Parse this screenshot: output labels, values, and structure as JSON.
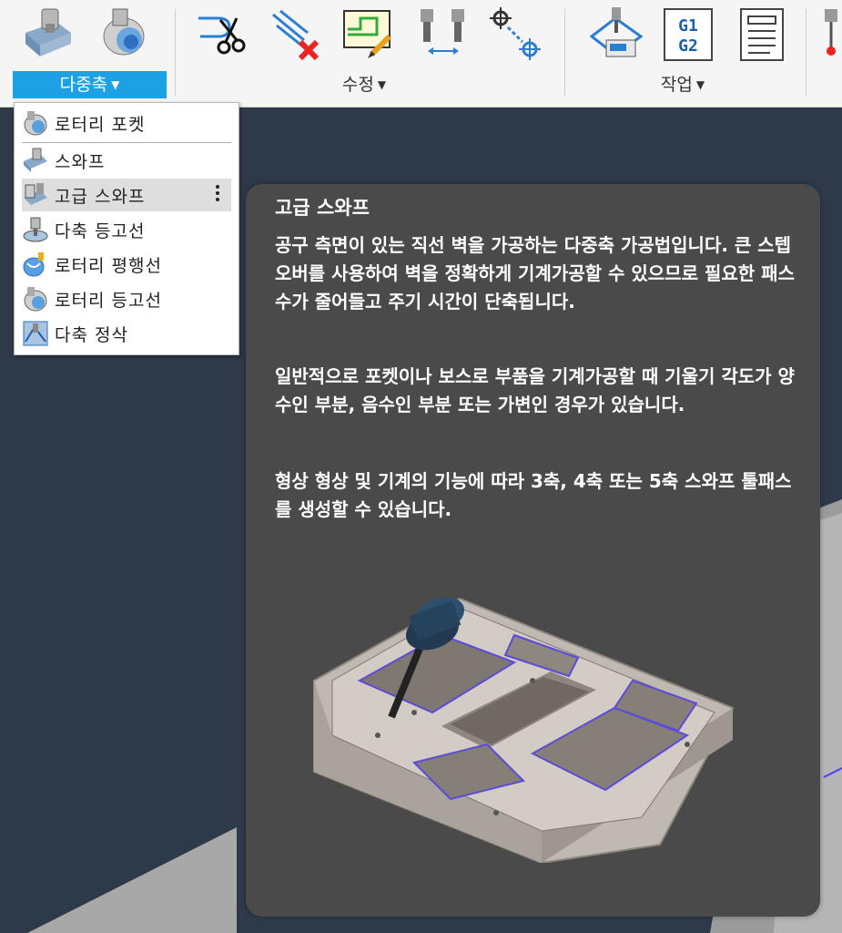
{
  "toolbar": {
    "groups": [
      {
        "label": "다중축",
        "active": true
      },
      {
        "label": "수정",
        "active": false
      },
      {
        "label": "작업",
        "active": false
      }
    ],
    "g1g2": {
      "line1": "G1",
      "line2": "G2"
    },
    "icons": [
      "multiaxis-contour-icon",
      "rotary-icon",
      "trim-icon",
      "delete-toolpath-icon",
      "edit-boundary-icon",
      "tool-compare-icon",
      "transform-point-icon",
      "machine-simulation-icon",
      "g1g2-icon",
      "setup-sheet-icon",
      "probe-icon"
    ]
  },
  "menu": {
    "items": [
      {
        "label": "로터리 포켓",
        "icon": "rotary-pocket-icon"
      },
      {
        "label": "스와프",
        "icon": "swarf-icon"
      },
      {
        "label": "고급 스와프",
        "icon": "advanced-swarf-icon",
        "hover": true
      },
      {
        "label": "다축 등고선",
        "icon": "multiaxis-contour-icon"
      },
      {
        "label": "로터리 평행선",
        "icon": "rotary-parallel-icon"
      },
      {
        "label": "로터리 등고선",
        "icon": "rotary-contour-icon"
      },
      {
        "label": "다축 정삭",
        "icon": "multiaxis-finishing-icon"
      }
    ]
  },
  "tooltip": {
    "title": "고급 스와프",
    "paragraphs": [
      "공구 측면이 있는 직선 벽을 가공하는 다중축 가공법입니다. 큰 스텝오버를 사용하여 벽을 정확하게 기계가공할 수 있으므로 필요한 패스 수가 줄어들고 주기 시간이 단축됩니다.",
      "일반적으로 포켓이나 보스로 부품을 기계가공할 때 기울기 각도가 양수인 부분, 음수인 부분 또는 가변인 경우가 있습니다.",
      "형상 형상 및 기계의 기능에 따라 3축, 4축 또는 5축 스와프 툴패스를 생성할 수 있습니다."
    ]
  },
  "colors": {
    "accent": "#1ea0e4",
    "tooltip_bg": "#4a4a4a",
    "viewport_bg": "#2e3a4a",
    "toolpath": "#6a5cff"
  }
}
